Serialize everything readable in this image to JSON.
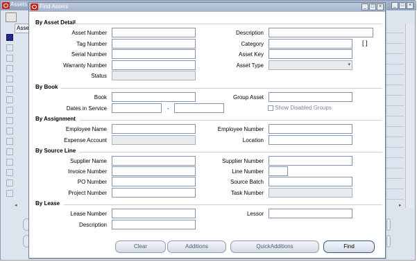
{
  "background_window": {
    "title": "Assets",
    "grid_header": "Asset"
  },
  "dialog": {
    "title": "Find Assets",
    "sections": {
      "asset_detail": "By Asset Detail",
      "book": "By Book",
      "assignment": "By Assignment",
      "source_line": "By Source Line",
      "lease": "By Lease"
    },
    "labels": {
      "asset_number": "Asset Number",
      "tag_number": "Tag Number",
      "serial_number": "Serial Number",
      "warranty_number": "Warranty Number",
      "status": "Status",
      "description": "Description",
      "category": "Category",
      "asset_key": "Asset Key",
      "asset_type": "Asset Type",
      "book": "Book",
      "dates_in_service": "Dates in Service",
      "date_separator": "-",
      "group_asset": "Group Asset",
      "show_disabled_groups": "Show Disabled Groups",
      "employee_name": "Employee Name",
      "expense_account": "Expense Account",
      "employee_number": "Employee Number",
      "location": "Location",
      "supplier_name": "Supplier Name",
      "invoice_number": "Invoice Number",
      "po_number": "PO Number",
      "project_number": "Project Number",
      "supplier_number": "Supplier Number",
      "line_number": "Line Number",
      "source_batch": "Source Batch",
      "task_number": "Task Number",
      "lease_number": "Lease Number",
      "lease_description": "Description",
      "lessor": "Lessor",
      "flex_indicator": "[ ]"
    },
    "buttons": {
      "clear": "Clear",
      "additions": "Additions",
      "quick_additions": "QuickAdditions",
      "find": "Find"
    },
    "title_controls": {
      "minimize": "_",
      "maximize": "□",
      "close": "×"
    }
  }
}
